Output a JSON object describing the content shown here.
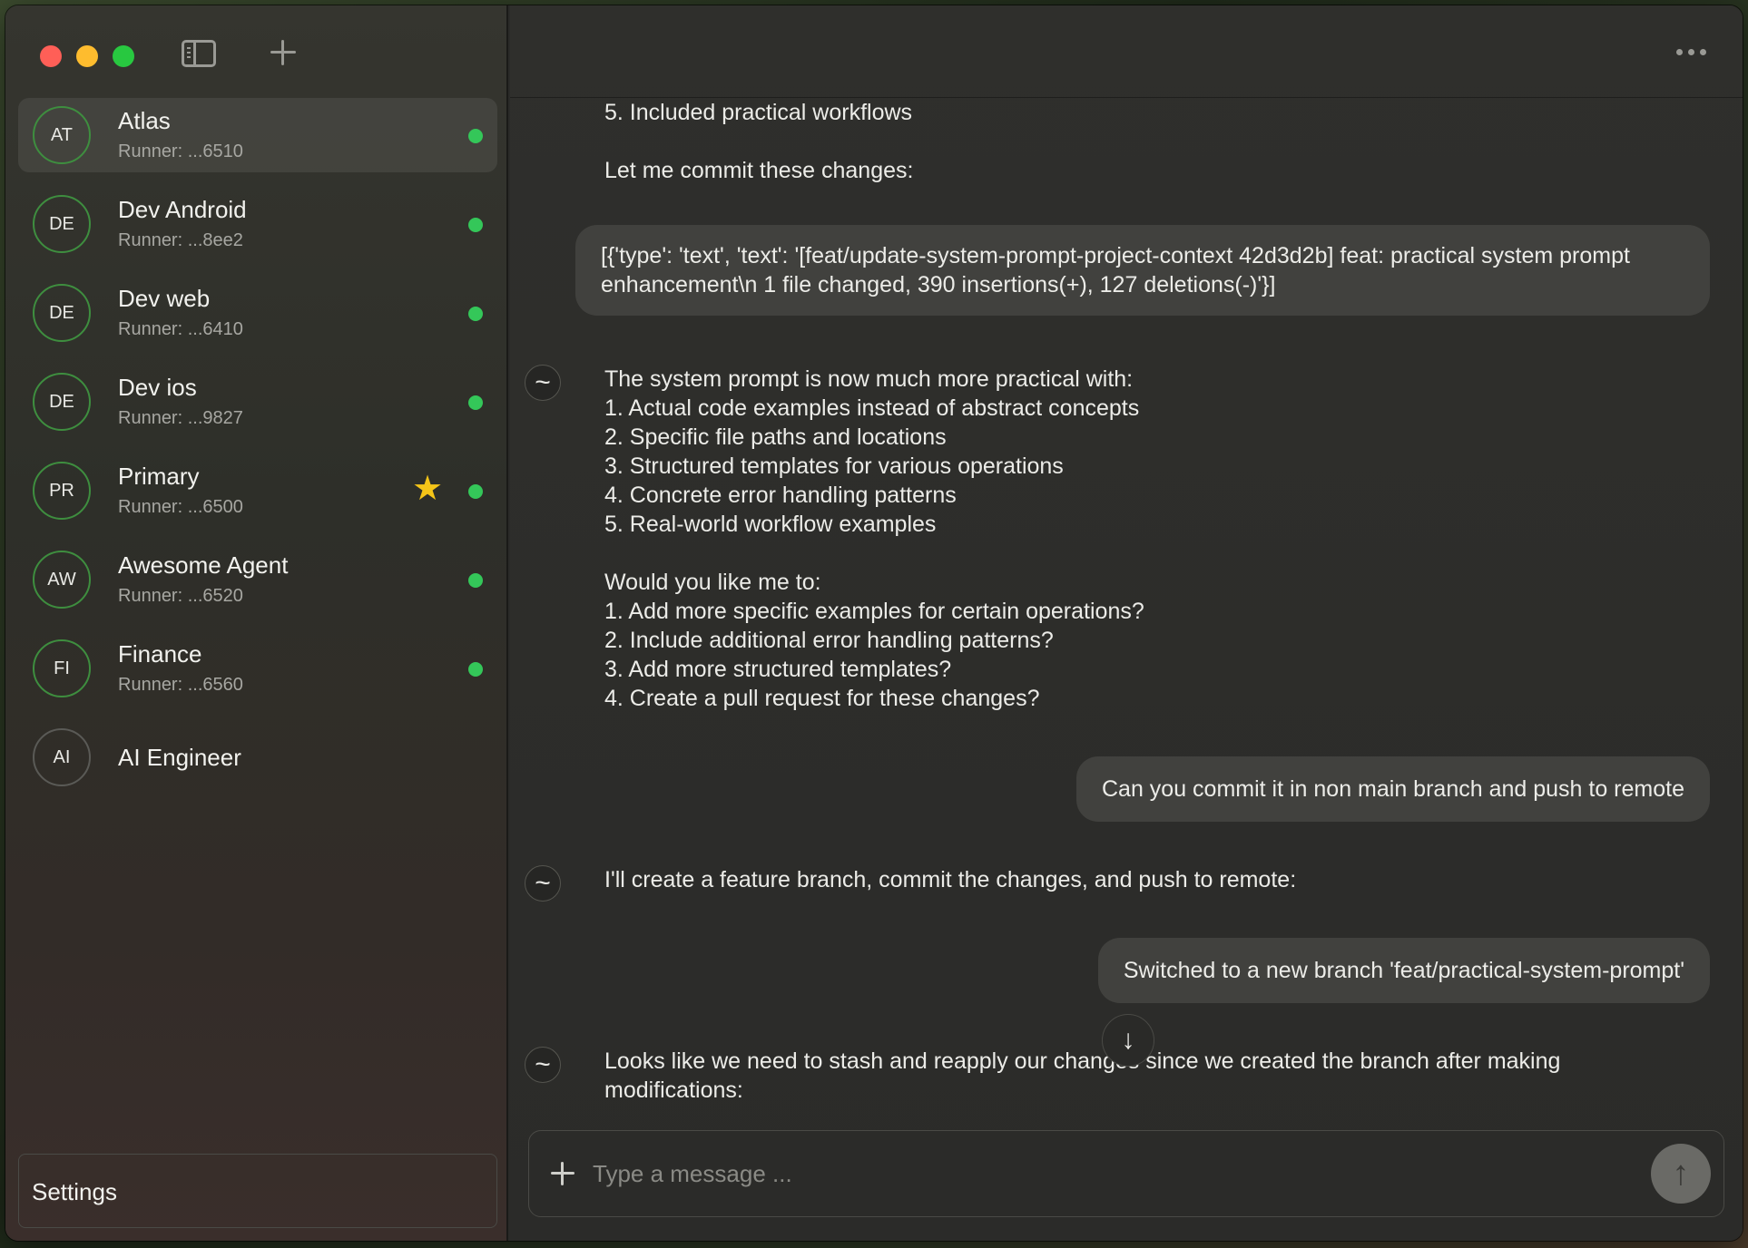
{
  "window": {
    "sidebar_toggle_icon": "sidebar-icon",
    "new_chat_icon": "plus-icon",
    "more_icon": "ellipsis-icon"
  },
  "sidebar": {
    "agents": [
      {
        "initials": "AT",
        "name": "Atlas",
        "runner": "Runner: ...6510",
        "online": true,
        "active": true
      },
      {
        "initials": "DE",
        "name": "Dev Android",
        "runner": "Runner: ...8ee2",
        "online": true
      },
      {
        "initials": "DE",
        "name": "Dev web",
        "runner": "Runner: ...6410",
        "online": true
      },
      {
        "initials": "DE",
        "name": "Dev ios",
        "runner": "Runner: ...9827",
        "online": true
      },
      {
        "initials": "PR",
        "name": "Primary",
        "runner": "Runner: ...6500",
        "online": true,
        "starred": true
      },
      {
        "initials": "AW",
        "name": "Awesome Agent",
        "runner": "Runner: ...6520",
        "online": true
      },
      {
        "initials": "FI",
        "name": "Finance",
        "runner": "Runner: ...6560",
        "online": true
      },
      {
        "initials": "AI",
        "name": "AI Engineer",
        "runner": "",
        "online": false
      }
    ],
    "settings_label": "Settings"
  },
  "chat": {
    "msg0_text": "5. Included practical workflows\n\nLet me commit these changes:",
    "tool_result": "[{'type': 'text', 'text': '[feat/update-system-prompt-project-context 42d3d2b] feat: practical system prompt enhancement\\n 1 file changed, 390 insertions(+), 127 deletions(-)'}]",
    "msg1_text": "The system prompt is now much more practical with:\n1. Actual code examples instead of abstract concepts\n2. Specific file paths and locations\n3. Structured templates for various operations\n4. Concrete error handling patterns\n5. Real-world workflow examples\n\nWould you like me to:\n1. Add more specific examples for certain operations?\n2. Include additional error handling patterns?\n3. Add more structured templates?\n4. Create a pull request for these changes?",
    "user1": "Can you commit it in non main branch and push to remote",
    "msg2_text": "I'll create a feature branch, commit the changes, and push to remote:",
    "tool2": "Switched to a new branch 'feat/practical-system-prompt'",
    "msg3_text": "Looks like we need to stash and reapply our changes since we created the branch after making\nmodifications:",
    "assistant_glyph": "~",
    "scroll_down_glyph": "↓"
  },
  "composer": {
    "placeholder": "Type a message ...",
    "send_glyph": "↑"
  },
  "colors": {
    "online": "#34c759",
    "star": "#f5c518",
    "bubble": "#41413e"
  }
}
